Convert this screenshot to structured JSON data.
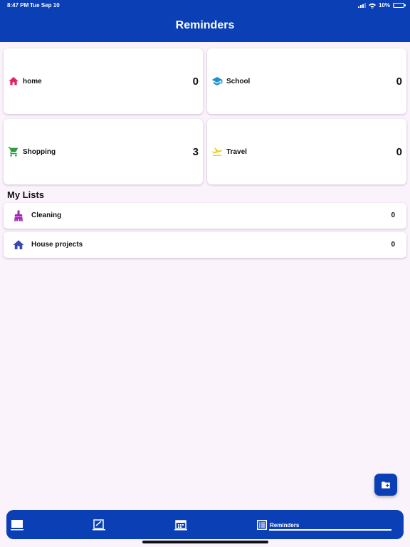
{
  "status_bar": {
    "time": "8:47 PM",
    "date": "Tue Sep 10",
    "battery": "10%",
    "battery_level": 0.1
  },
  "header": {
    "title": "Reminders"
  },
  "categories": [
    {
      "label": "home",
      "count": "0",
      "icon": "house-icon",
      "color": "#e0245e"
    },
    {
      "label": "School",
      "count": "0",
      "icon": "graduation-cap-icon",
      "color": "#1e90d6"
    },
    {
      "label": "Shopping",
      "count": "3",
      "icon": "shopping-cart-icon",
      "color": "#2e9e3e"
    },
    {
      "label": "Travel",
      "count": "0",
      "icon": "airplane-icon",
      "color": "#e8d31a"
    }
  ],
  "my_lists": {
    "title": "My Lists",
    "items": [
      {
        "label": "Cleaning",
        "count": "0",
        "icon": "broom-icon",
        "color": "#9c27b0"
      },
      {
        "label": "House projects",
        "count": "0",
        "icon": "house-icon",
        "color": "#3949ab"
      }
    ]
  },
  "fab": {
    "icon": "add-folder-icon"
  },
  "tabbar": {
    "tabs": [
      {
        "icon": "book-icon"
      },
      {
        "icon": "checklist-icon"
      },
      {
        "icon": "calendar-icon"
      },
      {
        "icon": "list-icon",
        "label": "Reminders",
        "active": true
      }
    ]
  },
  "colors": {
    "primary": "#0a3fb5",
    "background": "#fbf3fc"
  }
}
